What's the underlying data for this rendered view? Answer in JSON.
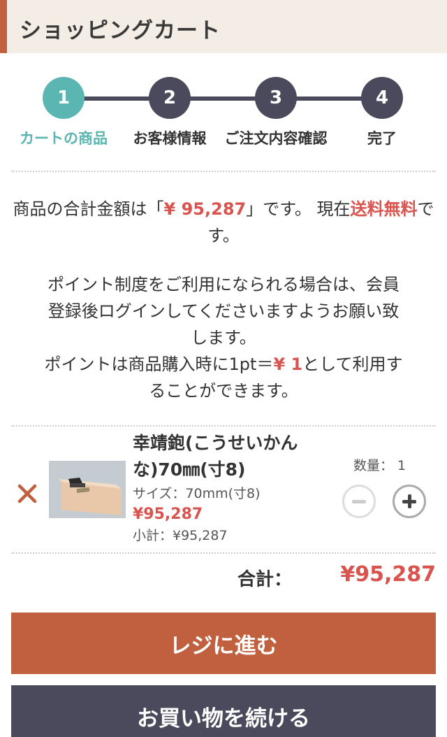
{
  "header": {
    "title": "ショッピングカート"
  },
  "steps": [
    {
      "number": "1",
      "label": "カートの商品",
      "active": true
    },
    {
      "number": "2",
      "label": "お客様情報",
      "active": false
    },
    {
      "number": "3",
      "label": "ご注文内容確認",
      "active": false
    },
    {
      "number": "4",
      "label": "完了",
      "active": false
    }
  ],
  "notice": {
    "total_prefix": "商品の合計金額は「",
    "total_amount": "¥ 95,287",
    "total_suffix": "」です。 現在",
    "free_shipping": "送料無料",
    "free_suffix": "です。",
    "points_line1": "ポイント制度をご利用になられる場合は、会員",
    "points_line2": "登録後ログインしてくださいますようお願い致",
    "points_line3": "します。",
    "rate_prefix": "ポイントは商品購入時に1pt＝",
    "rate_value": "¥ 1",
    "rate_suffix": "として利用す",
    "rate_line2": "ることができます。"
  },
  "item": {
    "name_line1": "幸靖鉋(こうせいかん",
    "name_line2": "な)70㎜(寸8)",
    "size": "サイズ：70mm(寸8)",
    "price": "¥95,287",
    "subtotal": "小計：¥95,287",
    "quantity_label": "数量： 1",
    "remove_icon": "close-icon",
    "thumbnail": "hand-plane-photo"
  },
  "total": {
    "label": "合計：",
    "value": "¥95,287"
  },
  "buttons": {
    "checkout": "レジに進む",
    "continue": "お買い物を続ける"
  },
  "colors": {
    "accent": "#c0603f",
    "teal": "#5bb5b0",
    "dark": "#4b4a5c",
    "price_red": "#d9534f",
    "header_bg": "#f3ede6"
  }
}
